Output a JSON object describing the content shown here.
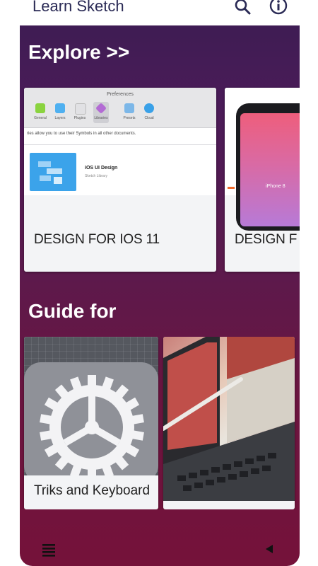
{
  "app_bar": {
    "title": "Learn Sketch",
    "search_icon": "search-icon",
    "info_icon": "info-icon"
  },
  "explore": {
    "title": "Explore >>",
    "cards": [
      {
        "caption": "DESIGN FOR IOS 11",
        "image": {
          "window_title": "Preferences",
          "tabs": [
            "General",
            "Layers",
            "Plugins",
            "Libraries",
            "Presets",
            "Cloud"
          ],
          "note": "ries allow you to use their Symbols in all other documents.",
          "library_name": "iOS UI Design",
          "library_sub": "Sketch Library"
        }
      },
      {
        "caption": "DESIGN F",
        "image": {
          "screen_label": "iPhone 8"
        }
      }
    ]
  },
  "guide": {
    "title": "Guide for",
    "cards": [
      {
        "caption": "Triks and Keyboard"
      },
      {
        "caption": ""
      }
    ]
  },
  "bottom_bar": {
    "menu_icon": "menu-icon",
    "back_icon": "back-triangle-icon"
  },
  "colors": {
    "header_bg": "#ffffff",
    "title_text": "#2a2a55",
    "background_top": "#3b1d52",
    "background_bottom": "#75123a",
    "card_bg": "#f3f4f6",
    "library_blue": "#3ba3ea"
  }
}
